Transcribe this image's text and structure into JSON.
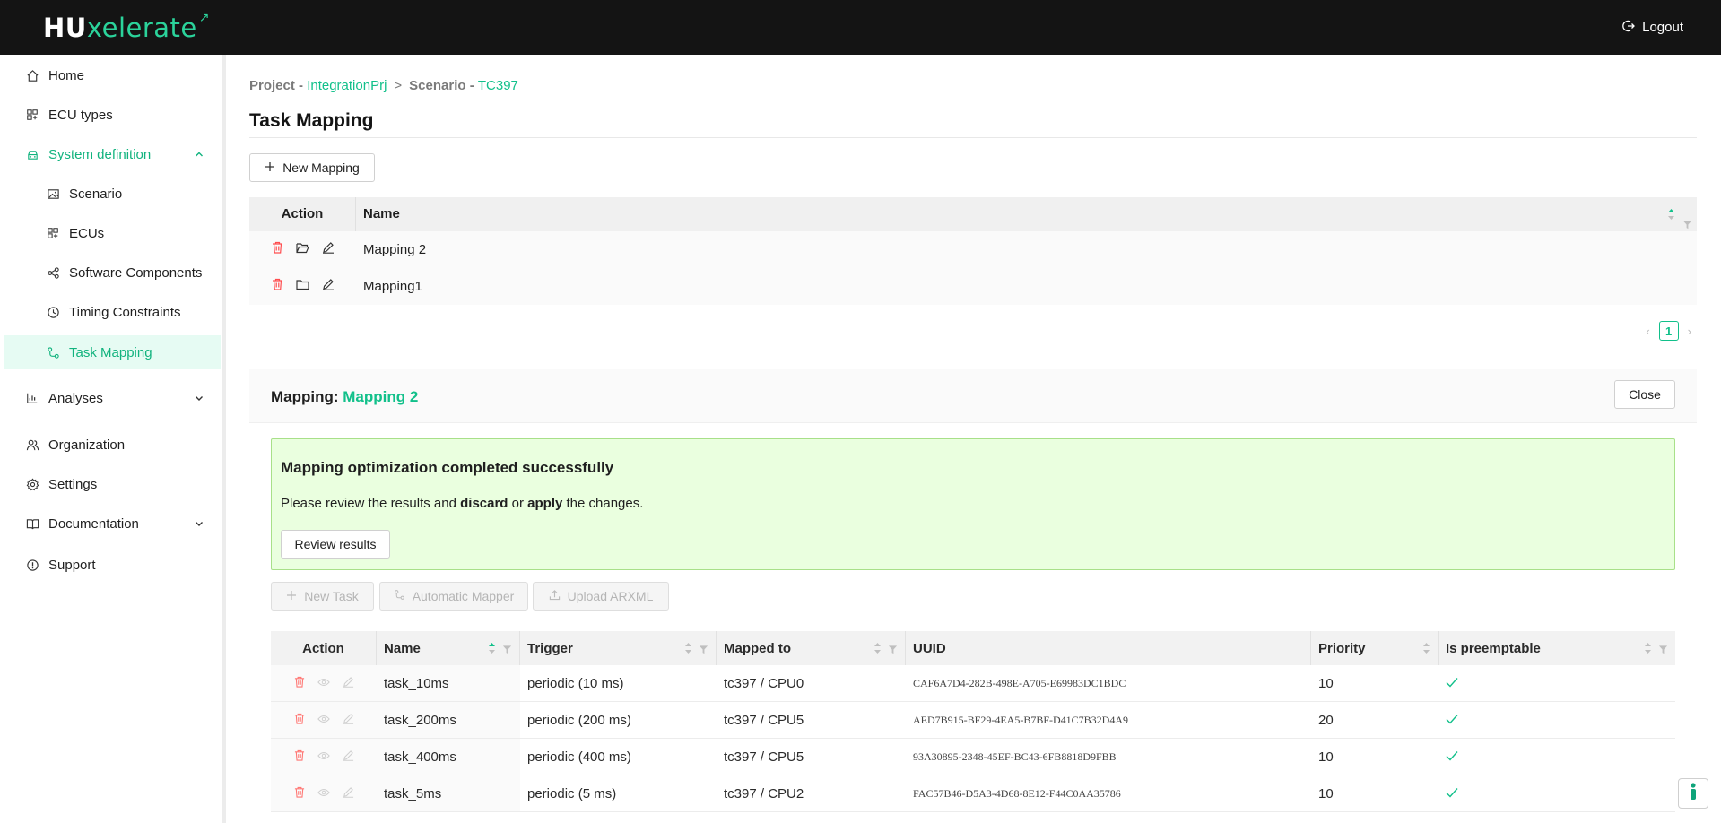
{
  "brand": {
    "prefix": "HU",
    "suffix": "xelerate"
  },
  "header": {
    "logout_label": "Logout"
  },
  "sidebar": {
    "home": "Home",
    "ecu_types": "ECU types",
    "system_definition": "System definition",
    "scenario": "Scenario",
    "ecus": "ECUs",
    "software_components": "Software Components",
    "timing_constraints": "Timing Constraints",
    "task_mapping": "Task Mapping",
    "analyses": "Analyses",
    "organization": "Organization",
    "settings": "Settings",
    "documentation": "Documentation",
    "support": "Support"
  },
  "breadcrumb": {
    "project_label": "Project - ",
    "project_value": "IntegrationPrj",
    "separator": ">",
    "scenario_label": "Scenario - ",
    "scenario_value": "TC397"
  },
  "page": {
    "title": "Task Mapping",
    "new_mapping_label": "New Mapping"
  },
  "mapping_table": {
    "columns": {
      "action": "Action",
      "name": "Name"
    },
    "rows": [
      {
        "name": "Mapping 2"
      },
      {
        "name": "Mapping1"
      }
    ]
  },
  "pagination": {
    "current_page": "1"
  },
  "mapping_panel": {
    "label": "Mapping: ",
    "name": "Mapping 2",
    "close_label": "Close",
    "alert": {
      "title": "Mapping optimization completed successfully",
      "text_before": "Please review the results and ",
      "discard": "discard",
      "text_middle": " or ",
      "apply": "apply",
      "text_after": " the changes.",
      "review_label": "Review results"
    },
    "toolbar": {
      "new_task_label": "New Task",
      "automatic_mapper_label": "Automatic Mapper",
      "upload_arxml_label": "Upload ARXML"
    },
    "task_table": {
      "columns": {
        "action": "Action",
        "name": "Name",
        "trigger": "Trigger",
        "mapped_to": "Mapped to",
        "uuid": "UUID",
        "priority": "Priority",
        "is_preemptable": "Is preemptable"
      },
      "rows": [
        {
          "name": "task_10ms",
          "trigger": "periodic (10 ms)",
          "mapped_to": "tc397 / CPU0",
          "uuid": "CAF6A7D4-282B-498E-A705-E69983DC1BDC",
          "priority": "10",
          "is_preemptable": true
        },
        {
          "name": "task_200ms",
          "trigger": "periodic (200 ms)",
          "mapped_to": "tc397 / CPU5",
          "uuid": "AED7B915-BF29-4EA5-B7BF-D41C7B32D4A9",
          "priority": "20",
          "is_preemptable": true
        },
        {
          "name": "task_400ms",
          "trigger": "periodic (400 ms)",
          "mapped_to": "tc397 / CPU5",
          "uuid": "93A30895-2348-45EF-BC43-6FB8818D9FBB",
          "priority": "10",
          "is_preemptable": true
        },
        {
          "name": "task_5ms",
          "trigger": "periodic (5 ms)",
          "mapped_to": "tc397 / CPU2",
          "uuid": "FAC57B46-D5A3-4D68-8E12-F44C0AA35786",
          "priority": "10",
          "is_preemptable": true
        }
      ]
    }
  },
  "colors": {
    "accent": "#11c08a",
    "topbar": "#141414",
    "alert_bg": "#eaffdf",
    "delete_red": "#ff4d4f"
  }
}
